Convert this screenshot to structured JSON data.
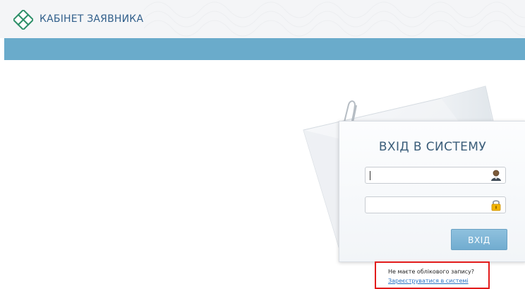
{
  "header": {
    "app_title": "КАБІНЕТ ЗАЯВНИКА"
  },
  "login": {
    "title": "ВХІД В СИСТЕМУ",
    "username": {
      "value": "",
      "placeholder": ""
    },
    "password": {
      "value": "",
      "placeholder": ""
    },
    "button_label": "ВХІД",
    "icons": {
      "username": "user-icon",
      "password": "lock-icon"
    }
  },
  "register": {
    "question": "Не маєте облікового запису?",
    "link_label": "Зареєструватися в системі"
  },
  "colors": {
    "header_bg": "#f4f5f7",
    "banner": "#6aabcb",
    "title": "#315f8b",
    "button": "#7ab4d6",
    "highlight_border": "#e21b1b",
    "link": "#2a74c4"
  }
}
